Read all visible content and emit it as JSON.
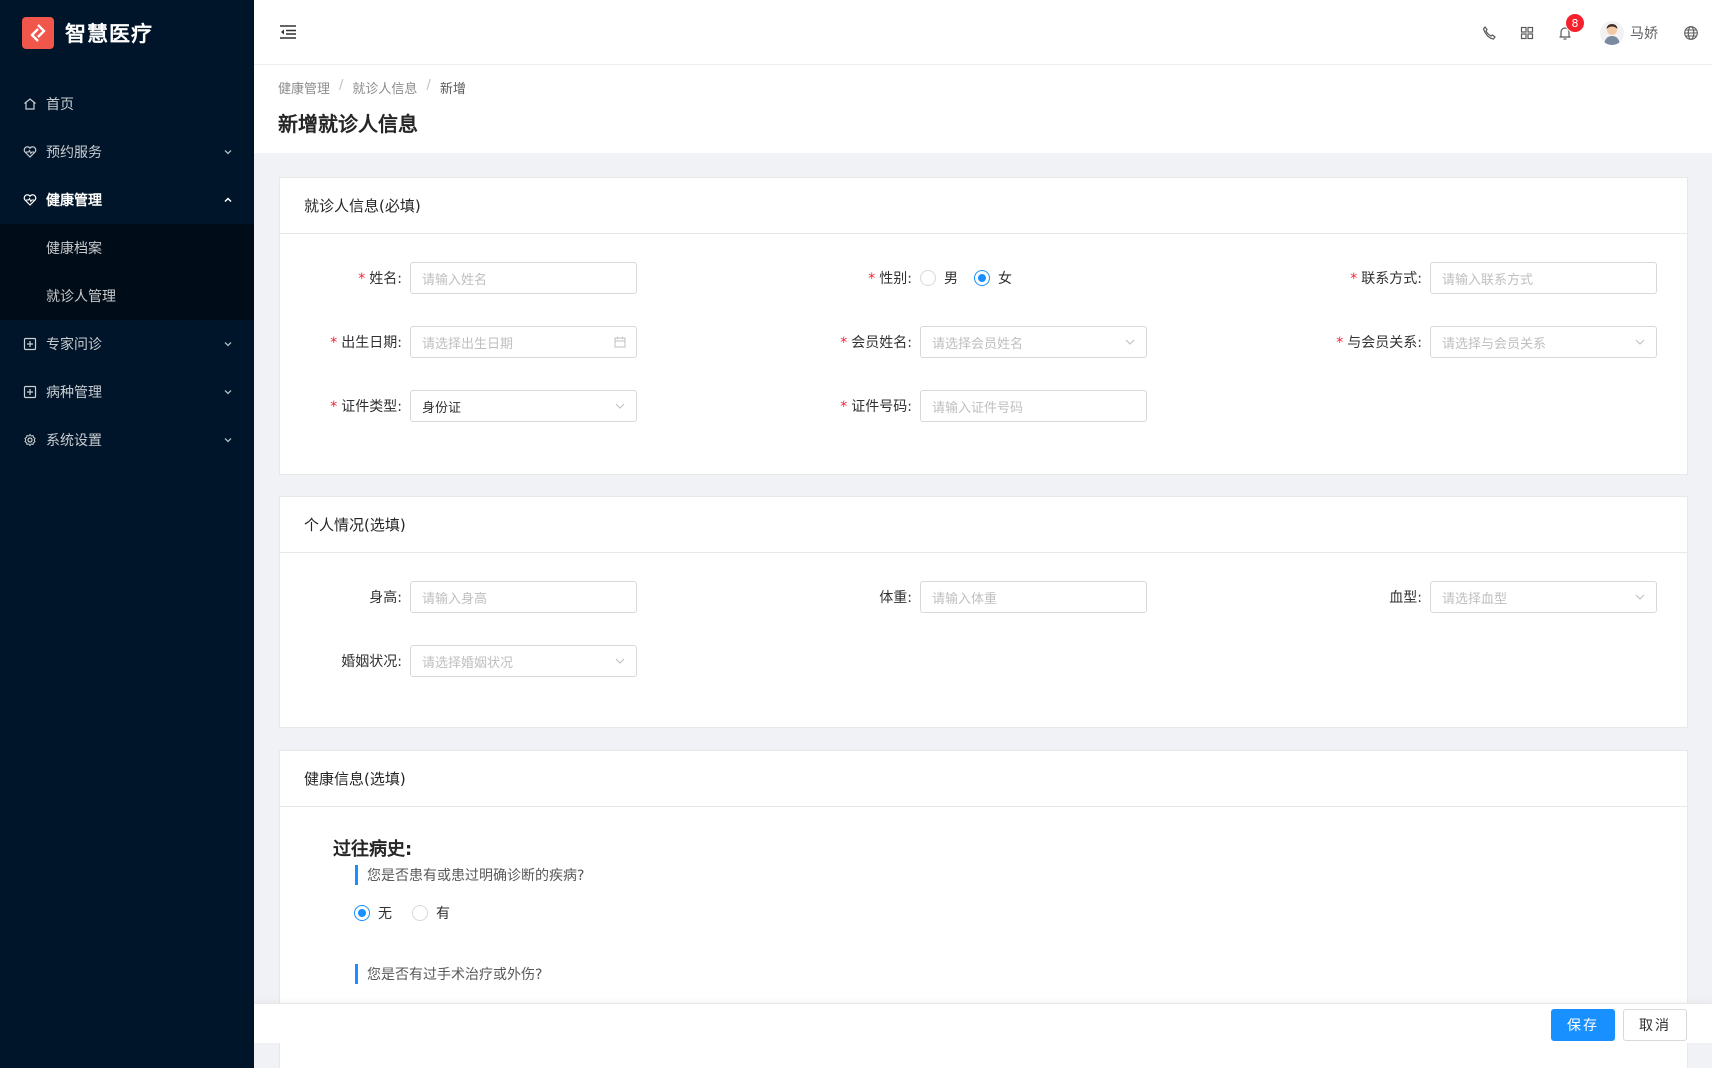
{
  "app": {
    "title": "智慧医疗"
  },
  "sidebar": {
    "items": [
      {
        "label": "首页",
        "icon": "home-icon"
      },
      {
        "label": "预约服务",
        "icon": "heart-pulse-icon"
      },
      {
        "label": "健康管理",
        "icon": "heart-pulse-icon",
        "open": true
      },
      {
        "label": "专家问诊",
        "icon": "plus-square-icon"
      },
      {
        "label": "病种管理",
        "icon": "plus-square-icon"
      },
      {
        "label": "系统设置",
        "icon": "gear-icon"
      }
    ],
    "submenu": [
      "健康档案",
      "就诊人管理"
    ]
  },
  "header": {
    "notification_count": "8",
    "user_name": "马娇"
  },
  "breadcrumb": [
    "健康管理",
    "就诊人信息",
    "新增"
  ],
  "page_title": "新增就诊人信息",
  "sections": {
    "required": {
      "title": "就诊人信息(必填)",
      "name": {
        "label": "姓名:",
        "placeholder": "请输入姓名"
      },
      "gender": {
        "label": "性别:",
        "options": [
          "男",
          "女"
        ],
        "selected": "女"
      },
      "contact": {
        "label": "联系方式:",
        "placeholder": "请输入联系方式"
      },
      "birthdate": {
        "label": "出生日期:",
        "placeholder": "请选择出生日期"
      },
      "member_name": {
        "label": "会员姓名:",
        "placeholder": "请选择会员姓名"
      },
      "relation": {
        "label": "与会员关系:",
        "placeholder": "请选择与会员关系"
      },
      "id_type": {
        "label": "证件类型:",
        "value": "身份证"
      },
      "id_number": {
        "label": "证件号码:",
        "placeholder": "请输入证件号码"
      }
    },
    "personal": {
      "title": "个人情况(选填)",
      "height": {
        "label": "身高:",
        "placeholder": "请输入身高"
      },
      "weight": {
        "label": "体重:",
        "placeholder": "请输入体重"
      },
      "blood_type": {
        "label": "血型:",
        "placeholder": "请选择血型"
      },
      "marital": {
        "label": "婚姻状况:",
        "placeholder": "请选择婚姻状况"
      }
    },
    "health": {
      "title": "健康信息(选填)",
      "history_title": "过往病史:",
      "q1": {
        "text": "您是否患有或患过明确诊断的疾病?",
        "options": [
          "无",
          "有"
        ],
        "selected": "无"
      },
      "q2": {
        "text": "您是否有过手术治疗或外伤?"
      }
    }
  },
  "footer": {
    "save_label": "保存",
    "cancel_label": "取消"
  },
  "colors": {
    "sidebar_bg": "#001529",
    "primary": "#1890ff",
    "required": "#f5222d",
    "logo": "#f0564a"
  }
}
